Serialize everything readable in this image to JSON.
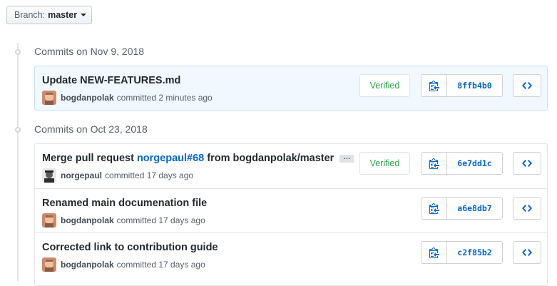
{
  "branch": {
    "label": "Branch:",
    "value": "master"
  },
  "groups": [
    {
      "title": "Commits on Nov 9, 2018",
      "commits": [
        {
          "title": "Update NEW-FEATURES.md",
          "author": "bogdanpolak",
          "time": "committed 2 minutes ago",
          "verified": "Verified",
          "sha": "8ffb4b0"
        }
      ]
    },
    {
      "title": "Commits on Oct 23, 2018",
      "commits": [
        {
          "title_prefix": "Merge pull request ",
          "title_link": "norgepaul#68",
          "title_suffix": " from bogdanpolak/master",
          "ellipsis": "…",
          "author": "norgepaul",
          "time": "committed 17 days ago",
          "verified": "Verified",
          "sha": "6e7dd1c"
        },
        {
          "title": "Renamed main documenation file",
          "author": "bogdanpolak",
          "time": "committed 17 days ago",
          "sha": "a6e8db7"
        },
        {
          "title": "Corrected link to contribution guide",
          "author": "bogdanpolak",
          "time": "committed 17 days ago",
          "sha": "c2f85b2"
        }
      ]
    }
  ],
  "colors": {
    "accent": "#0366d6",
    "verified": "#28a745",
    "highlight_bg": "#f1f8ff"
  },
  "icons": {
    "clipboard": "clipboard-icon",
    "browse": "code-icon",
    "caret": "caret-down-icon"
  }
}
